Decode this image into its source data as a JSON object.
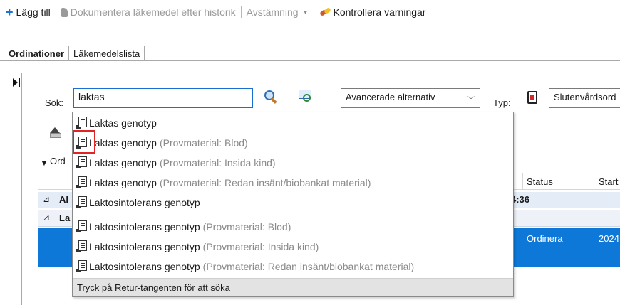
{
  "toolbar": {
    "add_label": "Lägg till",
    "document_label": "Dokumentera läkemedel efter historik",
    "reconcile_label": "Avstämning",
    "warnings_label": "Kontrollera varningar"
  },
  "tabs": [
    {
      "label": "Ordinationer",
      "active": true
    },
    {
      "label": "Läkemedelslista",
      "active": false
    }
  ],
  "search": {
    "label": "Sök:",
    "value": "laktas",
    "advanced_option": "Avancerade alternativ",
    "type_label": "Typ:",
    "type_value": "Slutenvårdsord"
  },
  "grid": {
    "group_toggle": "Ord",
    "headers": {
      "status": "Status",
      "start": "Start"
    },
    "group_rows": [
      {
        "label": "Al",
        "value": "4:36"
      },
      {
        "label": "La",
        "value": ""
      }
    ],
    "selected_row": {
      "status": "Ordinera",
      "start": "2024"
    }
  },
  "dropdown": {
    "items": [
      {
        "main": "Laktas genotyp",
        "sub": ""
      },
      {
        "main": "Laktas genotyp",
        "sub": "(Provmaterial: Blod)"
      },
      {
        "main": "Laktas genotyp",
        "sub": "(Provmaterial: Insida kind)"
      },
      {
        "main": "Laktas genotyp",
        "sub": "(Provmaterial: Redan insänt/biobankat material)"
      },
      {
        "main": "Laktosintolerans genotyp",
        "sub": ""
      },
      {
        "main": "Laktosintolerans genotyp",
        "sub": "(Provmaterial: Blod)"
      },
      {
        "main": "Laktosintolerans genotyp",
        "sub": "(Provmaterial: Insida kind)"
      },
      {
        "main": "Laktosintolerans genotyp",
        "sub": "(Provmaterial: Redan insänt/biobankat material)"
      }
    ],
    "footer": "Tryck på Retur-tangenten för att söka"
  },
  "colors": {
    "accent": "#1b75d0",
    "selection": "#0d78d8",
    "highlight_border": "#e02424"
  }
}
